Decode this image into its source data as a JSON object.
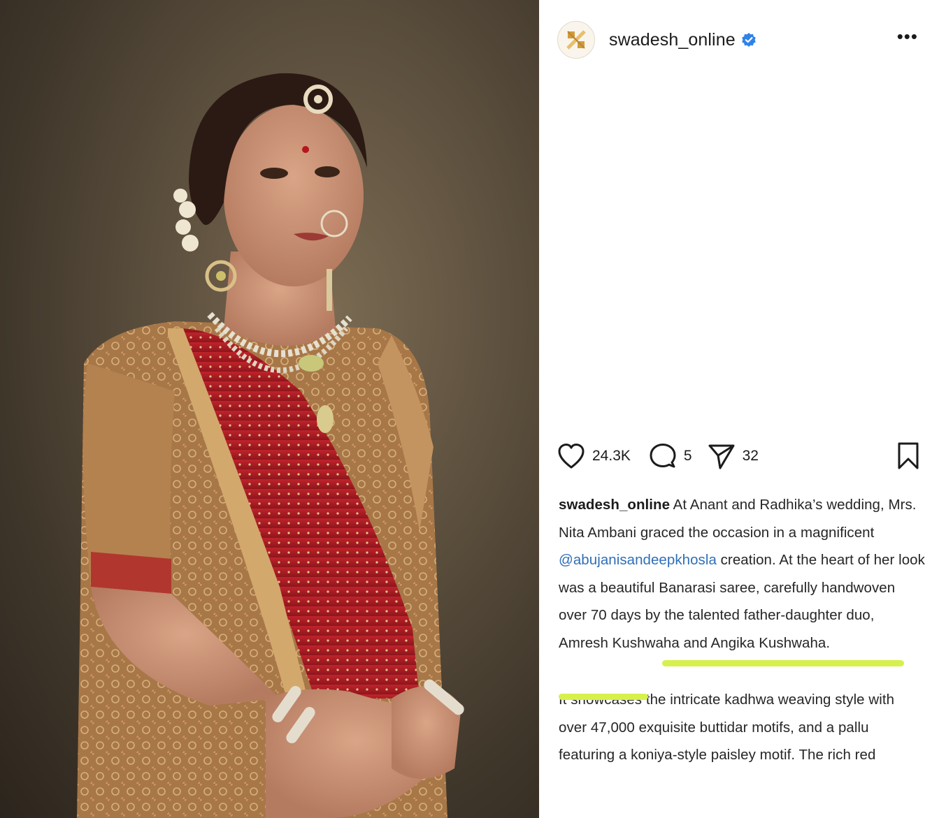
{
  "photo": {
    "alt_subject": "bridal-portrait"
  },
  "header": {
    "username": "swadesh_online",
    "avatar_icon": "brand-logo-icon",
    "verified_icon": "verified-badge-icon",
    "more_label": "•••"
  },
  "actions": {
    "likes": "24.3K",
    "comments": "5",
    "shares": "32"
  },
  "caption": {
    "username": "swadesh_online",
    "text_part1": " At Anant and Radhika’s wedding, Mrs. Nita Ambani graced the occasion in a magnificent ",
    "mention": "@abujanisandeepkhosla",
    "text_part2": " creation. At the heart of her look was a beautiful Banarasi saree, carefully handwoven over 70 days by the talented father-daughter duo, Amresh Kushwaha and Angika Kushwaha.",
    "paragraph2": "It showcases the intricate kadhwa weaving style with over 47,000 exquisite buttidar motifs, and a pallu featuring a koniya-style paisley motif. The rich red"
  },
  "colors": {
    "highlight": "#d7f04c",
    "mention": "#2f6fb7",
    "verified": "#2f83e8"
  }
}
